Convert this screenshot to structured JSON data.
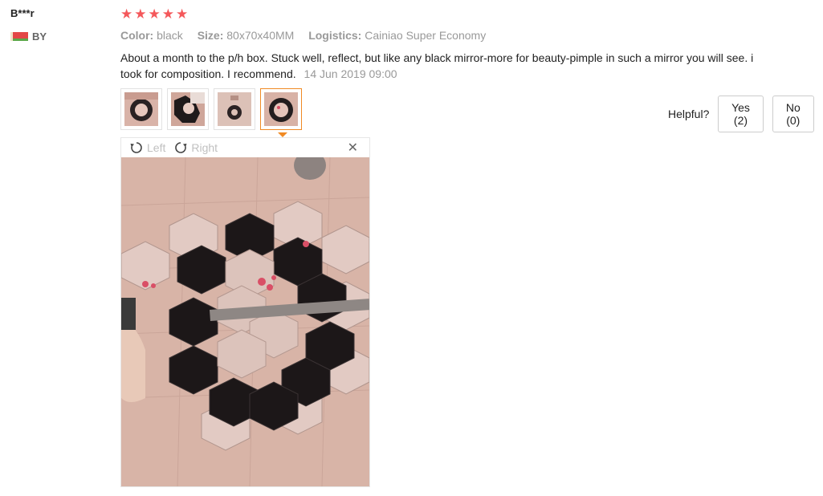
{
  "reviewer": {
    "name": "B***r",
    "country": "BY",
    "flag_icon": "belarus-flag-icon"
  },
  "rating": {
    "stars": 5,
    "max": 5,
    "color": "#f4585b"
  },
  "attributes": [
    {
      "label": "Color:",
      "value": "black"
    },
    {
      "label": "Size:",
      "value": "80x70x40MM"
    },
    {
      "label": "Logistics:",
      "value": "Cainiao Super Economy"
    }
  ],
  "review": {
    "text": "About a month to the p/h box. Stuck well, reflect, but like any black mirror-more for beauty-pimple in such a mirror you will see. i took for composition. I recommend.",
    "date": "14 Jun 2019 09:00"
  },
  "thumbnails": {
    "count": 4,
    "active_index": 3,
    "active_color": "#f08a24"
  },
  "viewer": {
    "rotate_left_label": "Left",
    "rotate_right_label": "Right",
    "close_icon": "close-icon"
  },
  "helpful": {
    "label": "Helpful?",
    "yes_label": "Yes (2)",
    "no_label": "No (0)"
  }
}
